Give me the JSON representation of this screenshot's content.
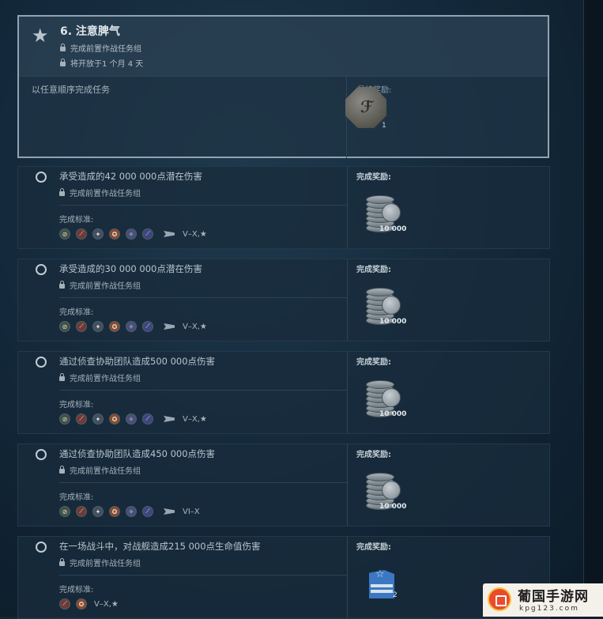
{
  "header": {
    "title": "6. 注意脾气",
    "prerequisite": "完成前置作战任务组",
    "opens_in": "将开放于1 个月 4 天",
    "order_note": "以任意顺序完成任务",
    "final_reward_label": "最终奖励:",
    "final_reward_count": "1"
  },
  "tasks": [
    {
      "title": "承受造成的42 000 000点潜在伤害",
      "lock_text": "完成前置作战任务组",
      "criteria_label": "完成标准:",
      "tier": "V–X,★",
      "reward_label": "完成奖励:",
      "reward_amount": "10 000"
    },
    {
      "title": "承受造成的30 000 000点潜在伤害",
      "lock_text": "完成前置作战任务组",
      "criteria_label": "完成标准:",
      "tier": "V–X,★",
      "reward_label": "完成奖励:",
      "reward_amount": "10 000"
    },
    {
      "title": "通过侦查协助团队造成500 000点伤害",
      "lock_text": "完成前置作战任务组",
      "criteria_label": "完成标准:",
      "tier": "V–X,★",
      "reward_label": "完成奖励:",
      "reward_amount": "10 000"
    },
    {
      "title": "通过侦查协助团队造成450 000点伤害",
      "lock_text": "完成前置作战任务组",
      "criteria_label": "完成标准:",
      "tier": "VI–X",
      "reward_label": "完成奖励:",
      "reward_amount": "10 000"
    },
    {
      "title": "在一场战斗中，对战舰造成215 000点生命值伤害",
      "lock_text": "完成前置作战任务组",
      "criteria_label": "完成标准:",
      "tier": "V–X,★",
      "reward_label": "完成奖励:",
      "reward_amount": "2"
    }
  ],
  "watermark": {
    "name": "葡国手游网",
    "url": "kpg123.com"
  }
}
